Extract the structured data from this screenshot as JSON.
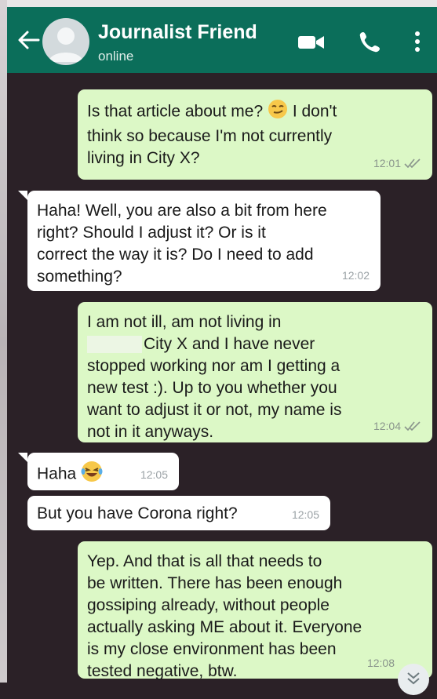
{
  "header": {
    "contact_name": "Journalist Friend",
    "status": "online",
    "icons": [
      "back-arrow-icon",
      "avatar-placeholder",
      "video-call-icon",
      "voice-call-icon",
      "more-options-icon"
    ],
    "color": "#0b6e5a"
  },
  "messages": [
    {
      "direction": "out",
      "text": "Is that article about me? 😏 I don't think so because I'm not currently living in City X?",
      "line1": "Is that article about me?",
      "line1b": "I don't",
      "line2": "think so because I'm not currently",
      "line3": "living in City X?",
      "time": "12:01",
      "status": "read"
    },
    {
      "direction": "in",
      "line1": "Haha! Well, you are also a bit from here",
      "line2": "right? Should I adjust it? Or is it",
      "line3": "correct the way it is? Do I need to add",
      "line4": "something?",
      "time": "12:02"
    },
    {
      "direction": "out",
      "line1": "I am not ill, am not living in",
      "line2": "City X and I have never",
      "line3": "stopped working nor am I getting a",
      "line4": "new test :). Up to you whether you",
      "line5": "want to adjust it or not, my name is",
      "line6": "not in it anyways.",
      "time": "12:04",
      "status": "read"
    },
    {
      "direction": "in",
      "line1": "Haha",
      "time": "12:05"
    },
    {
      "direction": "in",
      "line1": "But you have Corona right?",
      "time": "12:05"
    },
    {
      "direction": "out",
      "line1": "Yep. And that is all that needs to",
      "line2": "be written. There has been enough",
      "line3": "gossiping already, without people",
      "line4": "actually asking ME about it. Everyone",
      "line5": "is my close environment has been",
      "line6": "tested negative, btw.",
      "time": "12:08"
    }
  ],
  "colors": {
    "outgoing_bubble": "#dcf8c6",
    "incoming_bubble": "#ffffff",
    "chat_background": "#2b2127"
  }
}
